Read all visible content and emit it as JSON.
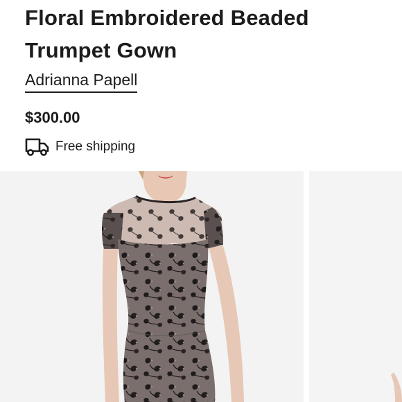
{
  "product": {
    "title": "Floral Embroidered Beaded Trumpet Gown",
    "brand": "Adrianna Papell",
    "price": "$300.00",
    "shipping_label": "Free shipping"
  },
  "icons": {
    "shipping": "delivery-truck-icon"
  },
  "gallery": {
    "images": [
      "dress-photo-front",
      "dress-photo-next"
    ]
  },
  "colors": {
    "text": "#1c1c1c",
    "photo_background": "#f3f3f3",
    "dress": "#7a6f6c"
  }
}
